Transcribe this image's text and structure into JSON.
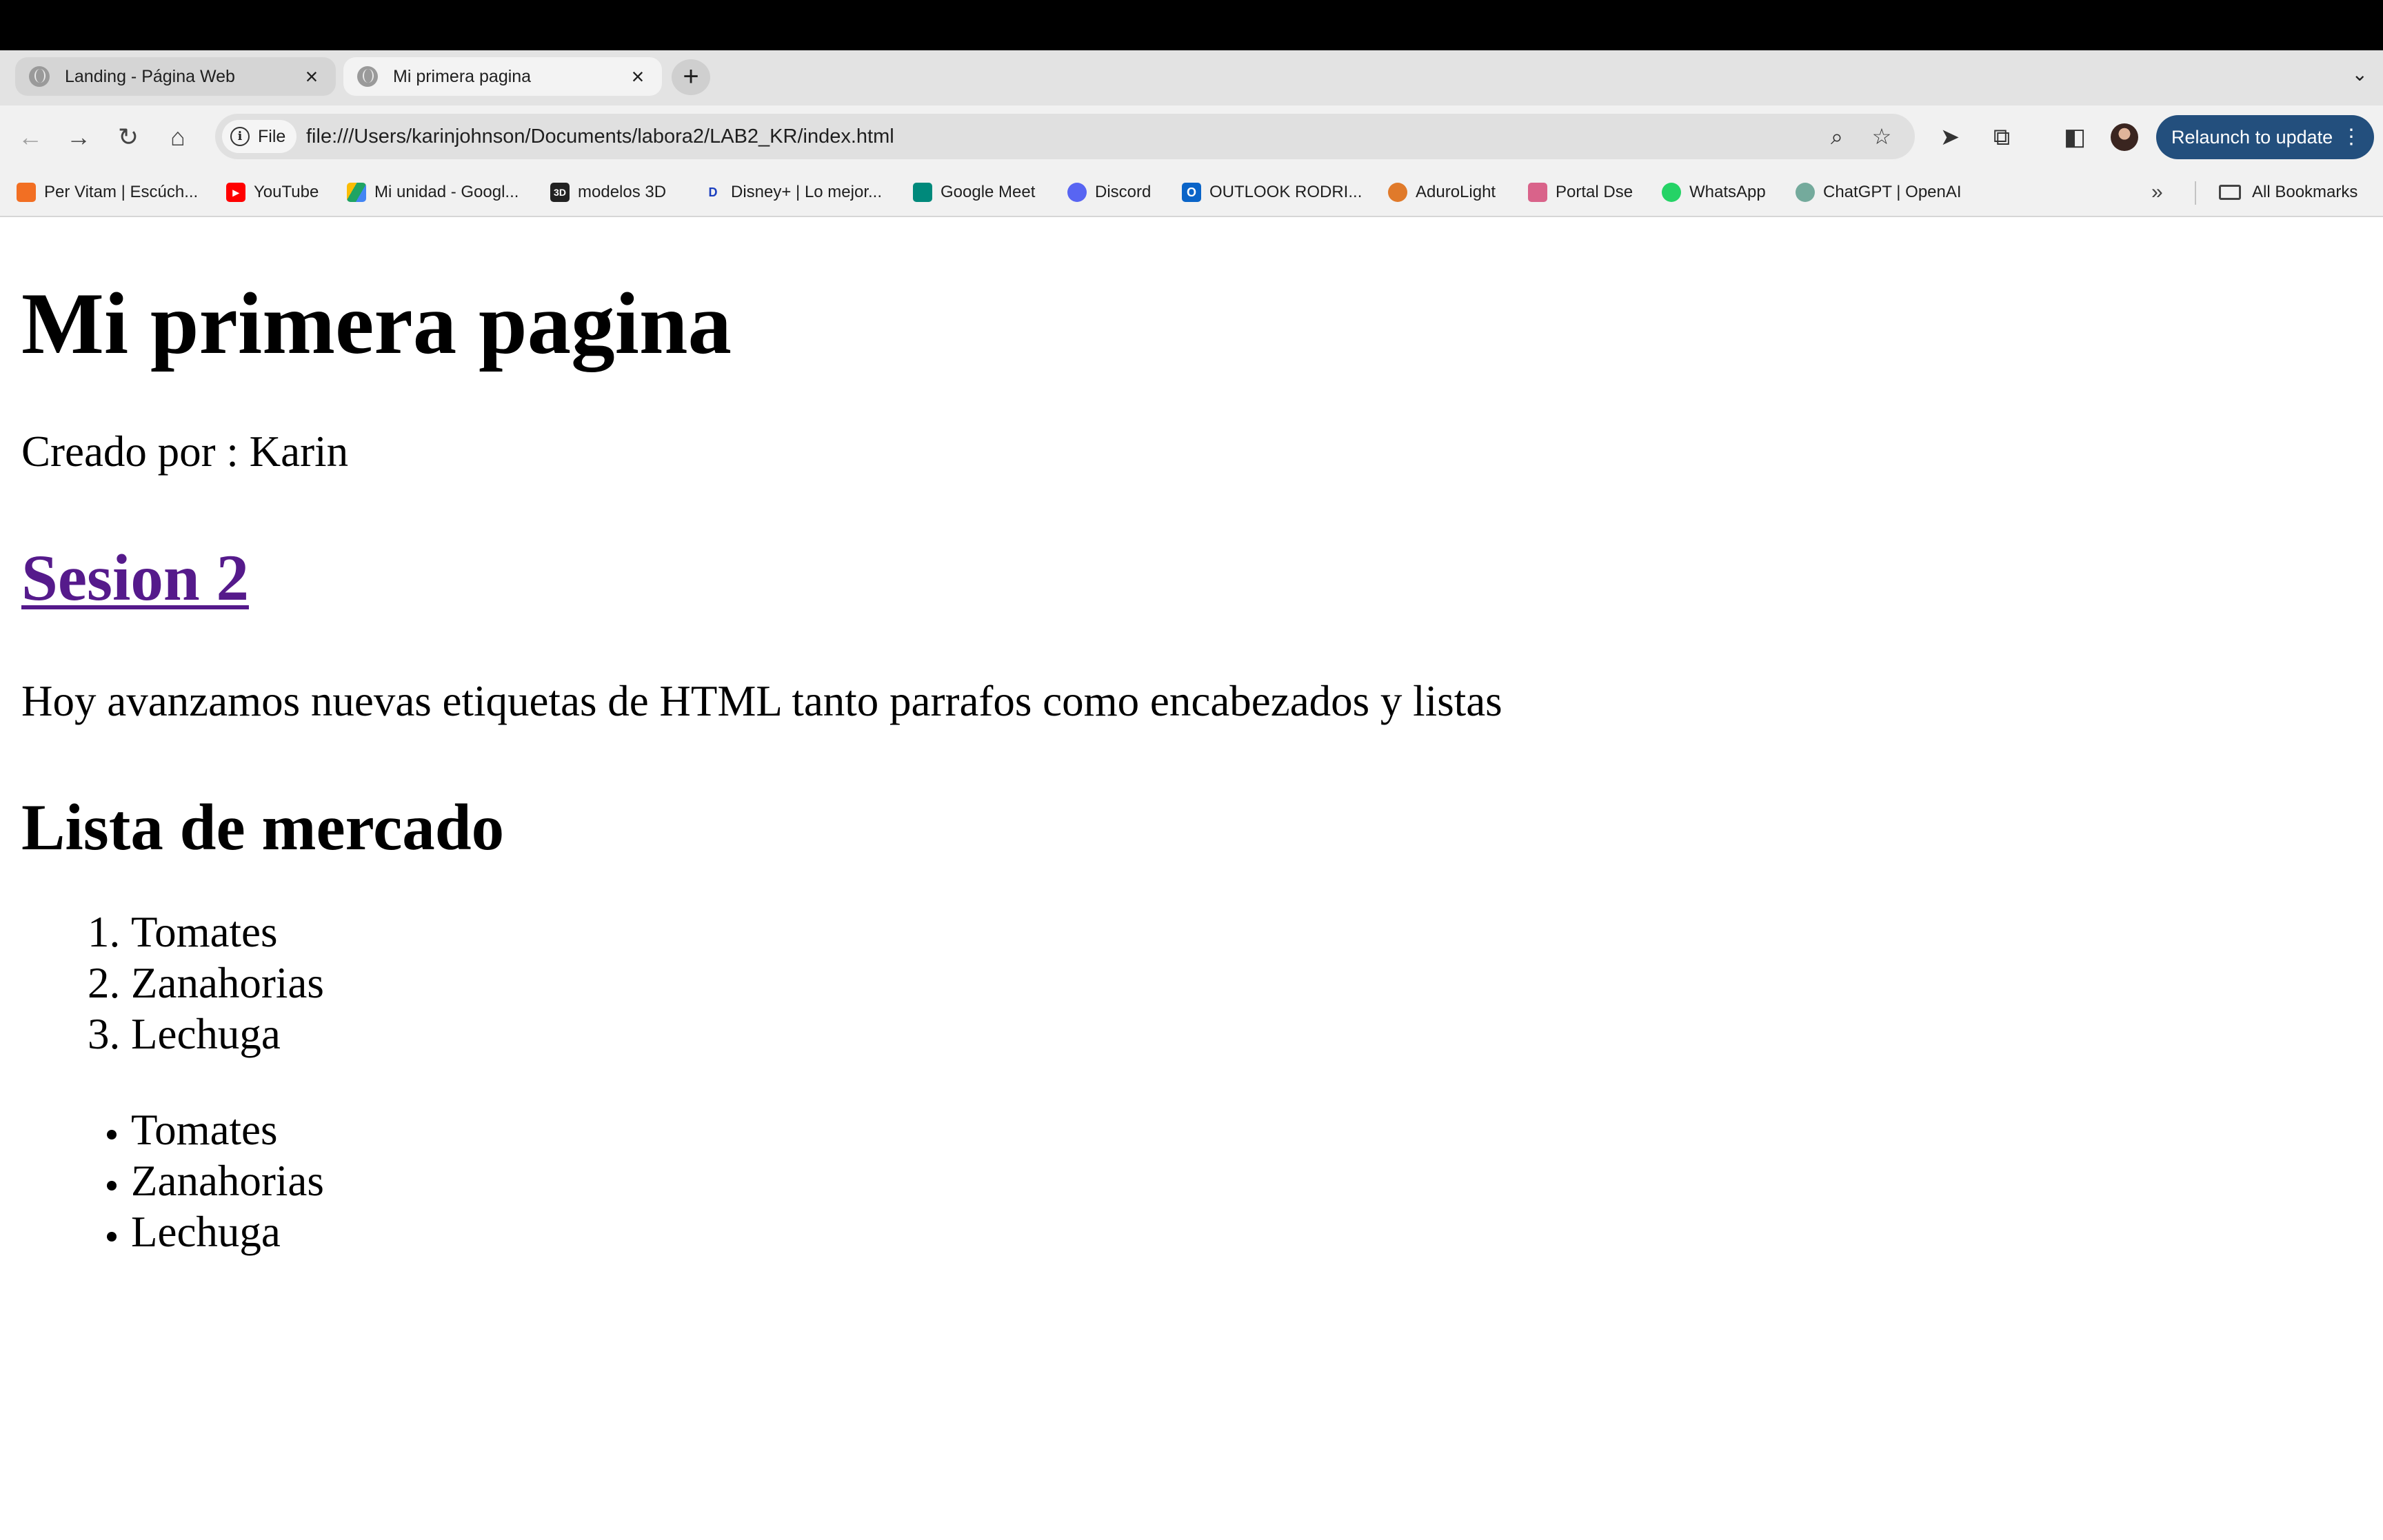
{
  "browser": {
    "tabs": [
      {
        "title": "Landing - Página Web",
        "active": false
      },
      {
        "title": "Mi primera pagina",
        "active": true
      }
    ],
    "omnibox": {
      "scheme_chip": "File",
      "url": "file:///Users/karinjohnson/Documents/labora2/LAB2_KR/index.html"
    },
    "relaunch_label": "Relaunch to update",
    "bookmarks": [
      {
        "label": "Per Vitam | Escúch...",
        "icon": "soundcloud-icon",
        "color": "#f26f23"
      },
      {
        "label": "YouTube",
        "icon": "youtube-icon",
        "color": "#ff0000"
      },
      {
        "label": "Mi unidad - Googl...",
        "icon": "google-drive-icon",
        "color": "#1fa463"
      },
      {
        "label": "modelos 3D",
        "icon": "3d-icon",
        "color": "#222222"
      },
      {
        "label": "Disney+ | Lo mejor...",
        "icon": "disney-icon",
        "color": "#1b3fbf"
      },
      {
        "label": "Google Meet",
        "icon": "google-meet-icon",
        "color": "#00897b"
      },
      {
        "label": "Discord",
        "icon": "discord-icon",
        "color": "#5865f2"
      },
      {
        "label": "OUTLOOK  RODRI...",
        "icon": "outlook-icon",
        "color": "#0a64c8"
      },
      {
        "label": "AduroLight",
        "icon": "adurolight-icon",
        "color": "#e07a2a"
      },
      {
        "label": "Portal Dse",
        "icon": "portal-icon",
        "color": "#d9638a"
      },
      {
        "label": "WhatsApp",
        "icon": "whatsapp-icon",
        "color": "#25d366"
      },
      {
        "label": "ChatGPT | OpenAI",
        "icon": "chatgpt-icon",
        "color": "#74aa9c"
      }
    ],
    "all_bookmarks_label": "All Bookmarks"
  },
  "page": {
    "heading": "Mi primera pagina",
    "byline": "Creado por : Karin",
    "session_link": "Sesion 2",
    "intro": "Hoy avanzamos nuevas etiquetas de HTML tanto parrafos como encabezados y listas",
    "list_heading": "Lista de mercado",
    "ordered_list": [
      "Tomates",
      "Zanahorias",
      "Lechuga"
    ],
    "unordered_list": [
      "Tomates",
      "Zanahorias",
      "Lechuga"
    ]
  },
  "colors": {
    "visited_link": "#551a8b",
    "relaunch_button": "#234f7d"
  }
}
